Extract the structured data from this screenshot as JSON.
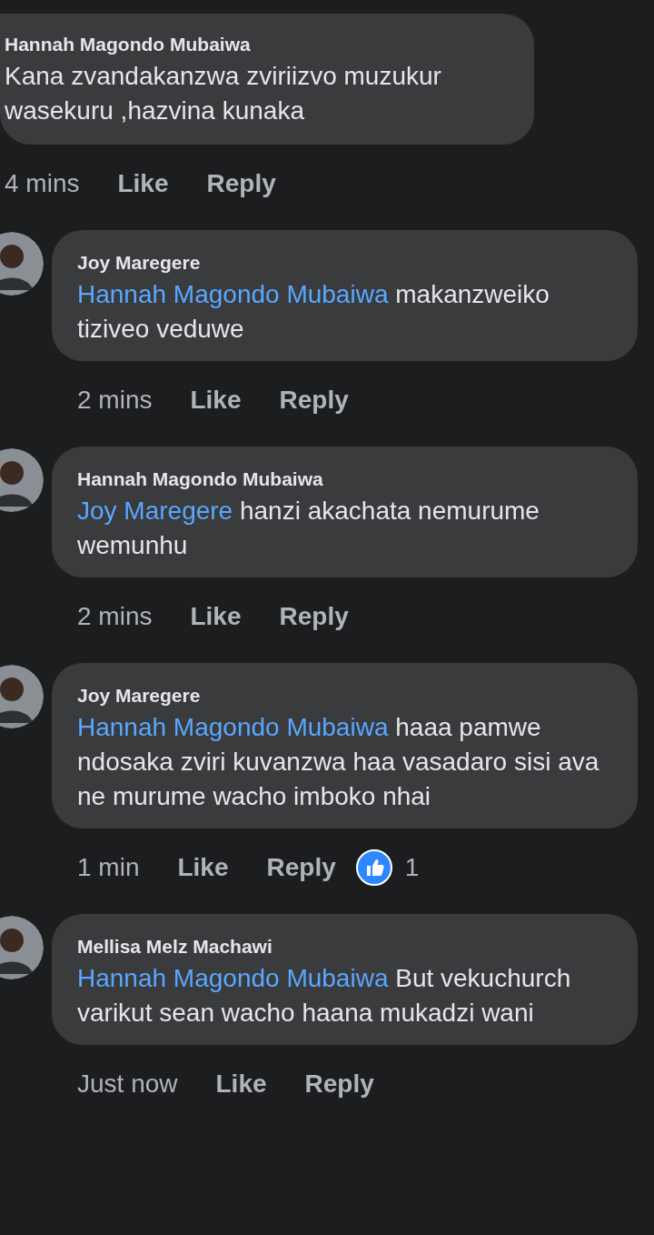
{
  "comments": [
    {
      "kind": "top",
      "author": "Hannah Magondo Mubaiwa",
      "text": "Kana zvandakanzwa zviriizvo muzukur wasekuru ,hazvina kunaka",
      "time": "4 mins",
      "actions": [
        "Like",
        "Reply"
      ]
    },
    {
      "kind": "reply",
      "author": "Joy Maregere",
      "mention": "Hannah Magondo Mubaiwa",
      "text": "makanzweiko tiziveo veduwe",
      "time": "2 mins",
      "actions": [
        "Like",
        "Reply"
      ]
    },
    {
      "kind": "reply",
      "author": "Hannah Magondo Mubaiwa",
      "mention": "Joy Maregere",
      "text": "hanzi akachata nemurume wemunhu",
      "time": "2 mins",
      "actions": [
        "Like",
        "Reply"
      ]
    },
    {
      "kind": "reply",
      "author": "Joy Maregere",
      "mention": "Hannah Magondo Mubaiwa",
      "text": "haaa pamwe ndosaka zviri kuvanzwa haa vasadaro sisi ava ne murume wacho imboko nhai",
      "time": "1 min",
      "actions": [
        "Like",
        "Reply"
      ],
      "likes": "1"
    },
    {
      "kind": "reply",
      "author": "Mellisa Melz Machawi",
      "mention": "Hannah Magondo Mubaiwa",
      "text": "But vekuchurch varikut sean wacho haana mukadzi wani",
      "time": "Just now",
      "actions": [
        "Like",
        "Reply"
      ]
    }
  ]
}
